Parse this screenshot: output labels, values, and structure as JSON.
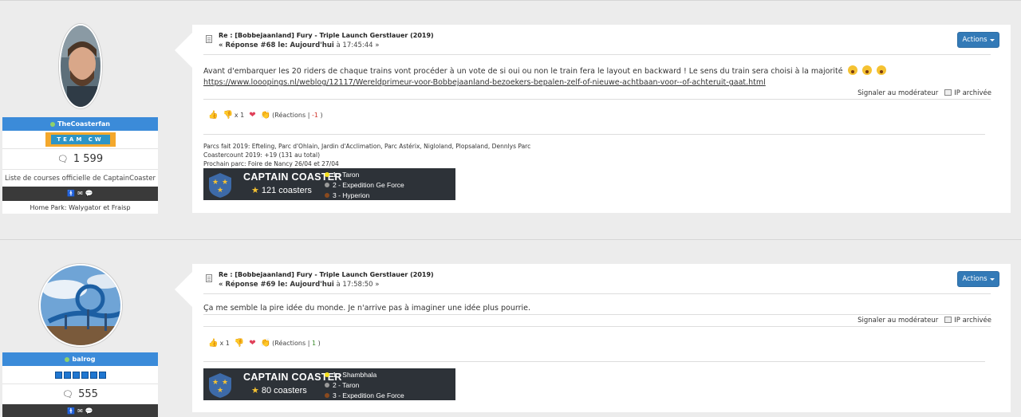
{
  "colors": {
    "accent": "#337ab7",
    "user_bar": "#3b8bd9",
    "gold": "#f5c232",
    "silver": "#9a9a9a",
    "bronze": "#a0522d"
  },
  "posts": [
    {
      "author": {
        "username": "TheCoasterfan",
        "team_label": "TEAM CW",
        "post_count": "1 599",
        "description": "Liste de courses officielle de CaptainCoaster",
        "home_park": "Home Park: Walygator et Fraisp"
      },
      "title": "Re : [Bobbejaanland] Fury - Triple Launch Gerstlauer (2019)",
      "reply_prefix": "« Réponse #68 le: Aujourd'hui",
      "time": "à 17:45:44 »",
      "actions_label": "Actions",
      "text": "Avant d'embarquer les 20 riders de chaque trains vont procéder à un vote de si oui ou non le train fera le layout en backward ! Le sens du train sera choisi à la majorité",
      "link": "https://www.looopings.nl/weblog/12117/Wereldprimeur-voor-Bobbejaanland-bezoekers-bepalen-zelf-of-nieuwe-achtbaan-voor--of-achteruit-gaat.html",
      "report_label": "Signaler au modérateur",
      "ip_label": "IP archivée",
      "reactions": {
        "thumbs_up_count": "",
        "thumbs_down_count": "x 1",
        "label_open": "(Réactions |",
        "score": "-1",
        "label_close": ")"
      },
      "signature": [
        "Parcs fait 2019: Efteling, Parc d'Ohlain, Jardin d'Acclimation, Parc Astérix, Nigloland, Plopsaland, Dennlys Parc",
        "Coastercount 2019: +19 (131 au total)",
        "Prochain parc: Foire de Nancy 26/04 et 27/04"
      ],
      "banner": {
        "brand": "CAPTAIN COASTER",
        "count": "121 coasters",
        "top": [
          "1 - Taron",
          "2 - Expedition Ge Force",
          "3 - Hyperion"
        ]
      }
    },
    {
      "author": {
        "username": "balrog",
        "post_count": "555"
      },
      "title": "Re : [Bobbejaanland] Fury - Triple Launch Gerstlauer (2019)",
      "reply_prefix": "« Réponse #69 le: Aujourd'hui",
      "time": "à 17:58:50 »",
      "actions_label": "Actions",
      "text": "Ça me semble la pire idée du monde. Je n'arrive pas à imaginer une idée plus pourrie.",
      "report_label": "Signaler au modérateur",
      "ip_label": "IP archivée",
      "reactions": {
        "thumbs_up_count": "x 1",
        "thumbs_down_count": "",
        "label_open": "(Réactions |",
        "score": "1",
        "label_close": ")"
      },
      "banner": {
        "brand": "CAPTAIN COASTER",
        "count": "80 coasters",
        "top": [
          "1 - Shambhala",
          "2 - Taron",
          "3 - Expedition Ge Force"
        ]
      }
    }
  ]
}
